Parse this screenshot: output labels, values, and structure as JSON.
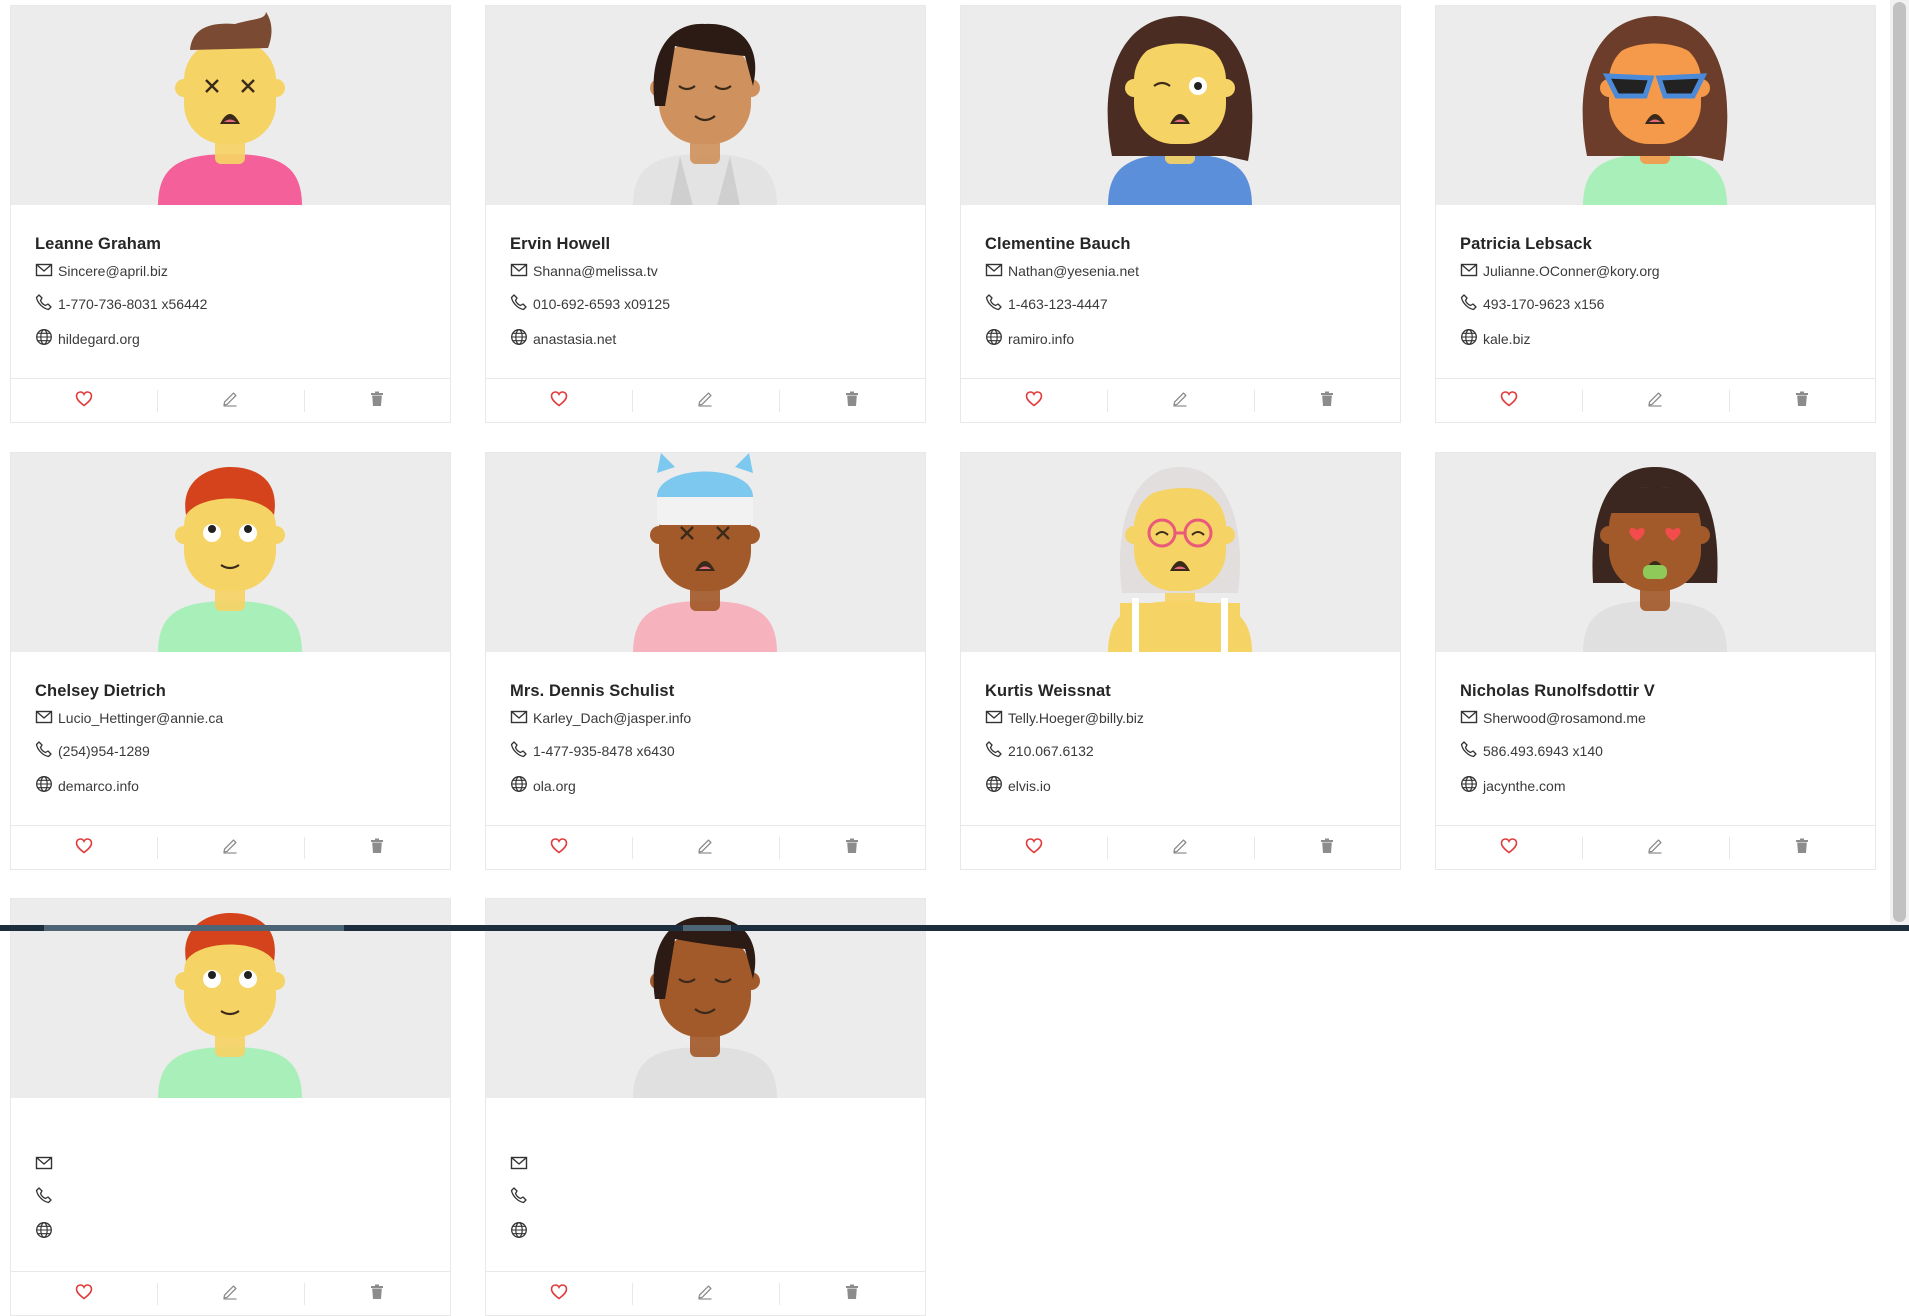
{
  "colors": {
    "heart": "#e03a3a",
    "icon_gray": "#8c8c8c",
    "card_border": "#e8e8e8",
    "avatar_bg": "#ececec"
  },
  "icons": {
    "email": "envelope-icon",
    "phone": "phone-icon",
    "website": "globe-icon",
    "like": "heart-icon",
    "edit": "pencil-icon",
    "delete": "trash-icon"
  },
  "users": [
    {
      "name": "Leanne Graham",
      "email": "Sincere@april.biz",
      "phone": "1-770-736-8031 x56442",
      "website": "hildegard.org",
      "avatar": {
        "skin": "#f6d365",
        "hair": "#7b4a32",
        "shirt": "#f3609a",
        "hair_style": "quiff",
        "eyes": "x"
      }
    },
    {
      "name": "Ervin Howell",
      "email": "Shanna@melissa.tv",
      "phone": "010-692-6593 x09125",
      "website": "anastasia.net",
      "avatar": {
        "skin": "#cf915d",
        "hair": "#2c1b14",
        "shirt": "#e3e3e3",
        "hair_style": "bob",
        "eyes": "closed"
      }
    },
    {
      "name": "Clementine Bauch",
      "email": "Nathan@yesenia.net",
      "phone": "1-463-123-4447",
      "website": "ramiro.info",
      "avatar": {
        "skin": "#f6d365",
        "hair": "#4a2c22",
        "shirt": "#5b8fd9",
        "hair_style": "long",
        "eyes": "wink"
      }
    },
    {
      "name": "Patricia Lebsack",
      "email": "Julianne.OConner@kory.org",
      "phone": "493-170-9623 x156",
      "website": "kale.biz",
      "avatar": {
        "skin": "#f59a4a",
        "hair": "#6b3d2a",
        "shirt": "#a8efba",
        "hair_style": "long",
        "eyes": "sunglasses"
      }
    },
    {
      "name": "Chelsey Dietrich",
      "email": "Lucio_Hettinger@annie.ca",
      "phone": "(254)954-1289",
      "website": "demarco.info",
      "avatar": {
        "skin": "#f6d365",
        "hair": "#d4431c",
        "shirt": "#a8efba",
        "hair_style": "short",
        "eyes": "up"
      }
    },
    {
      "name": "Mrs. Dennis Schulist",
      "email": "Karley_Dach@jasper.info",
      "phone": "1-477-935-8478 x6430",
      "website": "ola.org",
      "avatar": {
        "skin": "#a35a2a",
        "hair": "#7cc8ef",
        "shirt": "#f7b3bd",
        "hair_style": "beanie",
        "eyes": "x"
      }
    },
    {
      "name": "Kurtis Weissnat",
      "email": "Telly.Hoeger@billy.biz",
      "phone": "210.067.6132",
      "website": "elvis.io",
      "avatar": {
        "skin": "#f6d365",
        "hair": "#e2dede",
        "shirt": "#f6d365",
        "hair_style": "long-light",
        "eyes": "glasses"
      }
    },
    {
      "name": "Nicholas Runolfsdottir V",
      "email": "Sherwood@rosamond.me",
      "phone": "586.493.6943 x140",
      "website": "jacynthe.com",
      "avatar": {
        "skin": "#a35a2a",
        "hair": "#3b2720",
        "shirt": "#e0e0e0",
        "hair_style": "bob-bangs",
        "eyes": "hearts"
      }
    },
    {
      "name": "",
      "email": "",
      "phone": "",
      "website": "",
      "avatar": {
        "skin": "#f6d365",
        "hair": "#d4431c",
        "shirt": "#a8efba",
        "hair_style": "short",
        "eyes": "up"
      }
    },
    {
      "name": "",
      "email": "",
      "phone": "",
      "website": "",
      "avatar": {
        "skin": "#a35a2a",
        "hair": "#2c1b14",
        "shirt": "#e0e0e0",
        "hair_style": "bob",
        "eyes": "closed"
      }
    }
  ]
}
